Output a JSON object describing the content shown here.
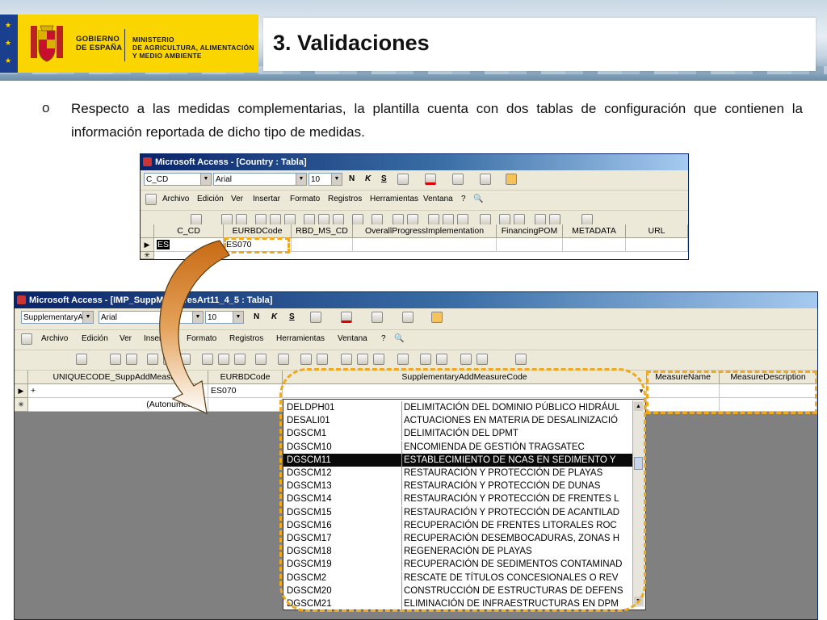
{
  "colors": {
    "accent_yellow": "#fbd500",
    "dash_orange": "#f0a91e",
    "titlebar_blue": "#0a246a",
    "highlight": "#0a0a0a",
    "gray_area": "#808080"
  },
  "header": {
    "gov_line1": "GOBIERNO",
    "gov_line2": "DE ESPAÑA",
    "min_line1": "MINISTERIO",
    "min_line2": "DE AGRICULTURA, ALIMENTACIÓN",
    "min_line3": "Y MEDIO AMBIENTE",
    "title": "3. Validaciones",
    "shield_icon": "coat-of-arms-icon"
  },
  "body": {
    "bullet": "o",
    "text": "Respecto a las medidas complementarias, la plantilla cuenta con dos tablas de configuración que contienen la información reportada de dicho tipo de medidas."
  },
  "win1": {
    "title": "Microsoft Access - [Country : Tabla]",
    "field_combo": "C_CD",
    "font_combo": "Arial",
    "size_combo": "10",
    "bold": "N",
    "italic": "K",
    "underline": "S",
    "menu": [
      "Archivo",
      "Edición",
      "Ver",
      "Insertar",
      "Formato",
      "Registros",
      "Herramientas",
      "Ventana",
      "?"
    ],
    "columns": [
      "C_CD",
      "EURBDCode",
      "RBD_MS_CD",
      "OverallProgressImplementation",
      "FinancingPOM",
      "METADATA",
      "URL"
    ],
    "row1": {
      "c_cd": "ES",
      "eurbd": "ES070"
    },
    "new_row_marker": "✳",
    "current_row_marker": "▶"
  },
  "win2": {
    "title": "Microsoft Access - [IMP_SuppMeasuresArt11_4_5 : Tabla]",
    "field_combo": "SupplementaryA",
    "font_combo": "Arial",
    "size_combo": "10",
    "bold": "N",
    "italic": "K",
    "underline": "S",
    "menu": [
      "Archivo",
      "Edición",
      "Ver",
      "Insertar",
      "Formato",
      "Registros",
      "Herramientas",
      "Ventana",
      "?"
    ],
    "columns": [
      "UNIQUECODE_SuppAddMeasure",
      "EURBDCode",
      "SupplementaryAddMeasureCode",
      "MeasureName",
      "MeasureDescription"
    ],
    "row1": {
      "plus": "+",
      "eurbd": "ES070"
    },
    "row2": {
      "uniq": "(Autonumérico)"
    },
    "dropdown": [
      {
        "code": "DELDPH01",
        "desc": "DELIMITACIÓN DEL DOMINIO PÚBLICO HIDRÁUL"
      },
      {
        "code": "DESALI01",
        "desc": "ACTUACIONES EN MATERIA DE DESALINIZACIÓ"
      },
      {
        "code": "DGSCM1",
        "desc": "DELIMITACIÓN DEL DPMT"
      },
      {
        "code": "DGSCM10",
        "desc": "ENCOMIENDA DE GESTIÓN TRAGSATEC"
      },
      {
        "code": "DGSCM11",
        "desc": "ESTABLECIMIENTO DE NCAS EN SEDIMENTO Y"
      },
      {
        "code": "DGSCM12",
        "desc": "RESTAURACIÓN Y PROTECCIÓN DE PLAYAS"
      },
      {
        "code": "DGSCM13",
        "desc": "RESTAURACIÓN Y PROTECCIÓN DE DUNAS"
      },
      {
        "code": "DGSCM14",
        "desc": "RESTAURACIÓN Y PROTECCIÓN DE FRENTES L"
      },
      {
        "code": "DGSCM15",
        "desc": "RESTAURACIÓN Y PROTECCIÓN DE ACANTILAD"
      },
      {
        "code": "DGSCM16",
        "desc": "RECUPERACIÓN DE FRENTES LITORALES ROC"
      },
      {
        "code": "DGSCM17",
        "desc": "RECUPERACIÓN DESEMBOCADURAS, ZONAS H"
      },
      {
        "code": "DGSCM18",
        "desc": "REGENERACIÓN DE PLAYAS"
      },
      {
        "code": "DGSCM19",
        "desc": "RECUPERACIÓN DE SEDIMENTOS CONTAMINAD"
      },
      {
        "code": "DGSCM2",
        "desc": "RESCATE DE TÍTULOS CONCESIONALES O REV"
      },
      {
        "code": "DGSCM20",
        "desc": "CONSTRUCCIÓN DE ESTRUCTURAS DE DEFENS"
      },
      {
        "code": "DGSCM21",
        "desc": "ELIMINACIÓN DE INFRAESTRUCTURAS EN DPM"
      }
    ],
    "highlighted_index": 4
  }
}
